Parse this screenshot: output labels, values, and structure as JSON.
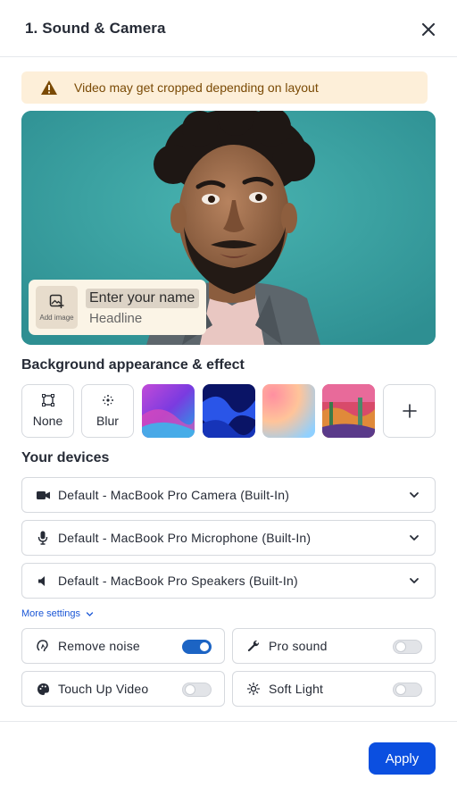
{
  "header": {
    "title": "1. Sound & Camera",
    "close_icon": "close-icon"
  },
  "warning": {
    "text": "Video may get cropped depending on layout",
    "icon": "warning-triangle-icon",
    "color": "#7a4a05"
  },
  "preview": {
    "background_color": "#3aa3a3",
    "name_card": {
      "add_image_label": "Add image",
      "name_placeholder": "Enter your name",
      "headline": "Headline"
    }
  },
  "background": {
    "title": "Background appearance & effect",
    "tiles": [
      {
        "label": "None",
        "icon": "crop-square-icon"
      },
      {
        "label": "Blur",
        "icon": "blur-dots-icon"
      },
      {
        "label": "",
        "kind": "image-purple-waves"
      },
      {
        "label": "",
        "kind": "image-blue-waves"
      },
      {
        "label": "",
        "kind": "image-pastel-gradient"
      },
      {
        "label": "",
        "kind": "image-painting"
      },
      {
        "label": "",
        "icon": "plus-icon"
      }
    ]
  },
  "devices": {
    "title": "Your devices",
    "items": [
      {
        "label": "Default - MacBook Pro Camera (Built-In)",
        "icon": "camera-icon"
      },
      {
        "label": "Default - MacBook Pro Microphone (Built-In)",
        "icon": "microphone-icon"
      },
      {
        "label": "Default - MacBook Pro Speakers (Built-In)",
        "icon": "speaker-icon"
      }
    ],
    "more_settings": "More settings"
  },
  "options": [
    {
      "label": "Remove noise",
      "icon": "noise-icon",
      "on": true
    },
    {
      "label": "Pro sound",
      "icon": "wrench-icon",
      "on": false
    },
    {
      "label": "Touch Up Video",
      "icon": "palette-icon",
      "on": false
    },
    {
      "label": "Soft Light",
      "icon": "sun-icon",
      "on": false
    }
  ],
  "footer": {
    "apply_label": "Apply",
    "accent": "#0b4fe0"
  }
}
